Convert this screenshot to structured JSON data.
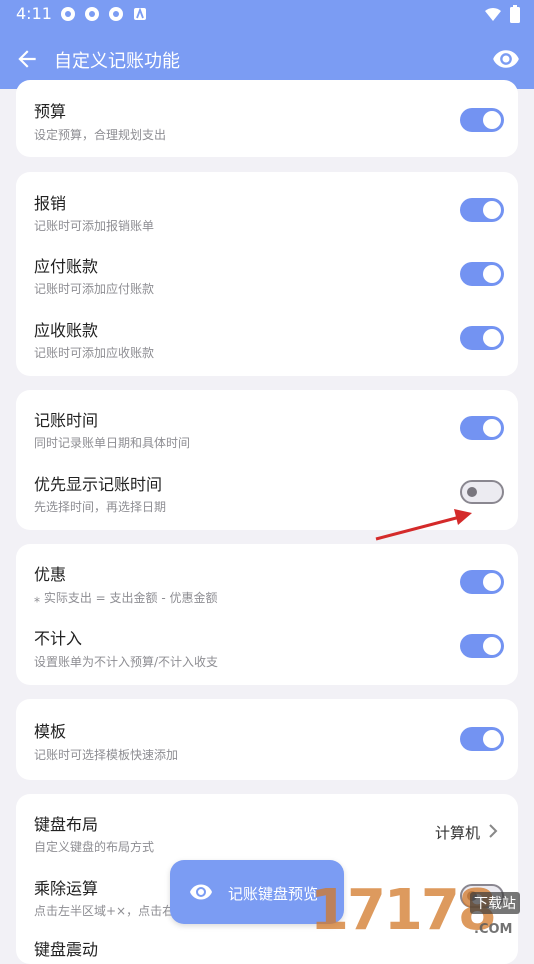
{
  "status": {
    "time": "4:11"
  },
  "appbar": {
    "title": "自定义记账功能"
  },
  "sections": {
    "budget": {
      "title": "预算",
      "sub": "设定预算，合理规划支出",
      "on": true
    },
    "reimburse": {
      "title": "报销",
      "sub": "记账时可添加报销账单",
      "on": true
    },
    "payable": {
      "title": "应付账款",
      "sub": "记账时可添加应付账款",
      "on": true
    },
    "receivable": {
      "title": "应收账款",
      "sub": "记账时可添加应收账款",
      "on": true
    },
    "record_time": {
      "title": "记账时间",
      "sub": "同时记录账单日期和具体时间",
      "on": true
    },
    "time_first": {
      "title": "优先显示记账时间",
      "sub": "先选择时间，再选择日期",
      "on": false
    },
    "discount": {
      "title": "优惠",
      "sub": "⁎ 实际支出 = 支出金额 - 优惠金额",
      "on": true
    },
    "exclude": {
      "title": "不计入",
      "sub": "设置账单为不计入预算/不计入收支",
      "on": true
    },
    "template": {
      "title": "模板",
      "sub": "记账时可选择模板快速添加",
      "on": true
    },
    "keyboard_layout": {
      "title": "键盘布局",
      "sub": "自定义键盘的布局方式",
      "value": "计算机"
    },
    "muldiv": {
      "title": "乘除运算",
      "sub": "点击左半区域+×，点击右"
    },
    "keyboard_vibrate": {
      "title": "键盘震动"
    }
  },
  "fab": {
    "label": "记账键盘预览"
  },
  "watermark": {
    "number": "17178",
    "badge": "下载站",
    "domain": ".COM"
  },
  "colors": {
    "primary": "#7b9cf3",
    "toggle_on": "#7393f2",
    "background": "#f2f1f6",
    "arrow": "#d42a2a"
  },
  "icons": [
    "back-arrow-icon",
    "eye-icon",
    "chevron-right-icon",
    "wifi-icon",
    "battery-icon"
  ]
}
